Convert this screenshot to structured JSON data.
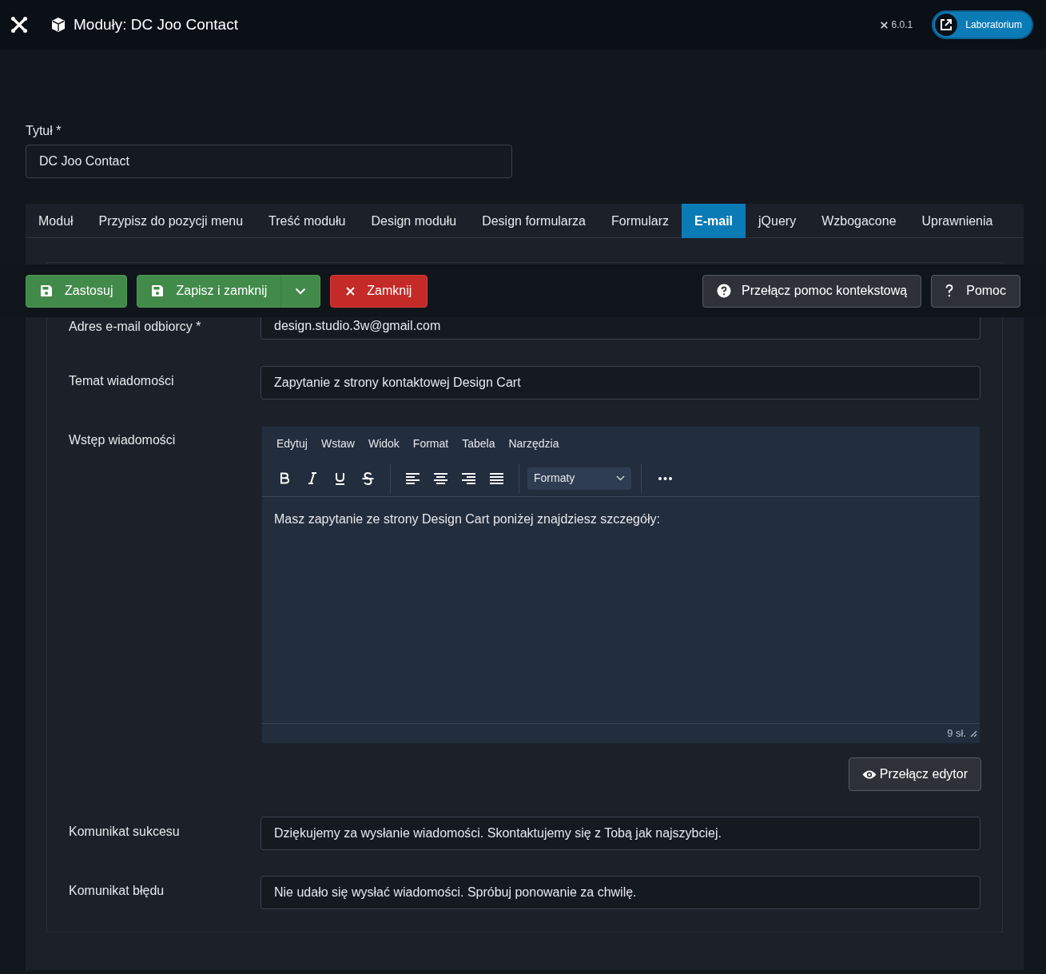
{
  "header": {
    "title": "Moduły: DC Joo Contact",
    "version": "6.0.1",
    "site_button": "Laboratorium"
  },
  "title_field": {
    "label": "Tytuł *",
    "value": "DC Joo Contact"
  },
  "tabs": [
    {
      "label": "Moduł",
      "selected": false
    },
    {
      "label": "Przypisz do pozycji menu",
      "selected": false
    },
    {
      "label": "Treść modułu",
      "selected": false
    },
    {
      "label": "Design modułu",
      "selected": false
    },
    {
      "label": "Design formularza",
      "selected": false
    },
    {
      "label": "Formularz",
      "selected": false
    },
    {
      "label": "E-mail",
      "selected": true
    },
    {
      "label": "jQuery",
      "selected": false
    },
    {
      "label": "Wzbogacone",
      "selected": false
    },
    {
      "label": "Uprawnienia",
      "selected": false
    }
  ],
  "toolbar": [
    {
      "kind": "apply",
      "label": "Zastosuj"
    },
    {
      "kind": "save_close",
      "label": "Zapisz i zamknij"
    },
    {
      "kind": "close",
      "label": "Zamknij"
    },
    {
      "kind": "help_toggle",
      "label": "Przełącz pomoc kontekstową"
    },
    {
      "kind": "help",
      "label": "Pomoc"
    }
  ],
  "fields": [
    {
      "kind": "text",
      "label": "Adres e-mail odbiorcy *",
      "value": "design.studio.3w@gmail.com"
    },
    {
      "kind": "text",
      "label": "Temat wiadomości",
      "value": "Zapytanie z strony kontaktowej Design Cart"
    },
    {
      "kind": "editor",
      "label": "Wstęp wiadomości",
      "menu": [
        "Edytuj",
        "Wstaw",
        "Widok",
        "Format",
        "Tabela",
        "Narzędzia"
      ],
      "formats": "Formaty",
      "content": "Masz zapytanie ze strony Design Cart poniżej znajdziesz szczegóły:",
      "word_count": "9 sł.",
      "toggle_button": "Przełącz edytor"
    },
    {
      "kind": "text",
      "label": "Komunikat sukcesu",
      "value": "Dziękujemy za wysłanie wiadomości. Skontaktujemy się z Tobą jak najszybciej."
    },
    {
      "kind": "text",
      "label": "Komunikat błędu",
      "value": "Nie udało się wysłać wiadomości. Spróbuj ponowanie za chwilę."
    }
  ]
}
